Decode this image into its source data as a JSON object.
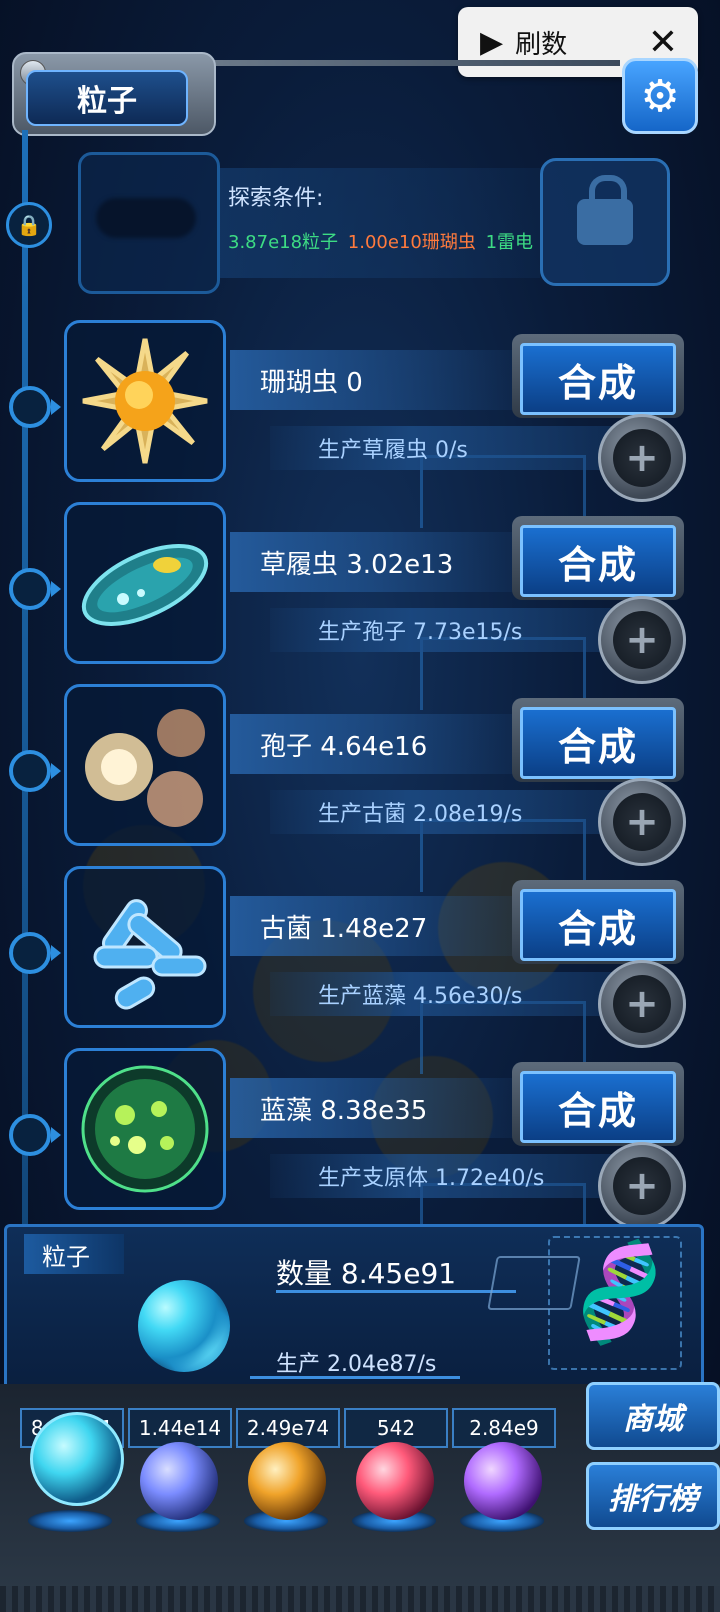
{
  "popup": {
    "label": "刷数"
  },
  "header": {
    "title": "粒子"
  },
  "locked": {
    "condition_title": "探索条件:",
    "req1": "3.87e18粒子",
    "req2": "1.00e10珊瑚虫",
    "req3": "1雷电",
    "colors": {
      "req1": "#3ddc84",
      "req2": "#ff7a3d",
      "req3": "#3ddc84"
    }
  },
  "rows": [
    {
      "name": "珊瑚虫 0",
      "production": "生产草履虫 0/s",
      "button": "合成",
      "icon": "sun-creature-icon"
    },
    {
      "name": "草履虫 3.02e13",
      "production": "生产孢子 7.73e15/s",
      "button": "合成",
      "icon": "paramecium-icon"
    },
    {
      "name": "孢子 4.64e16",
      "production": "生产古菌 2.08e19/s",
      "button": "合成",
      "icon": "spore-icon"
    },
    {
      "name": "古菌 1.48e27",
      "production": "生产蓝藻 4.56e30/s",
      "button": "合成",
      "icon": "archaea-icon"
    },
    {
      "name": "蓝藻 8.38e35",
      "production": "生产支原体 1.72e40/s",
      "button": "合成",
      "icon": "cyanobacteria-icon"
    }
  ],
  "panel": {
    "tag": "粒子",
    "quantity": "数量 8.45e91",
    "production": "生产 2.04e87/s"
  },
  "resources": [
    {
      "value": "8.45e91",
      "icon": "particle-orb-icon",
      "color": "#3fd6f0"
    },
    {
      "value": "1.44e14",
      "icon": "lightning-orb-icon",
      "color": "#7b8cff"
    },
    {
      "value": "2.49e74",
      "icon": "galaxy-orb-icon",
      "color": "#f0a32a"
    },
    {
      "value": "542",
      "icon": "brain-orb-icon",
      "color": "#ff5a7a"
    },
    {
      "value": "2.84e9",
      "icon": "vortex-orb-icon",
      "color": "#b06bff"
    }
  ],
  "side_buttons": {
    "shop": "商城",
    "rank": "排行榜"
  }
}
